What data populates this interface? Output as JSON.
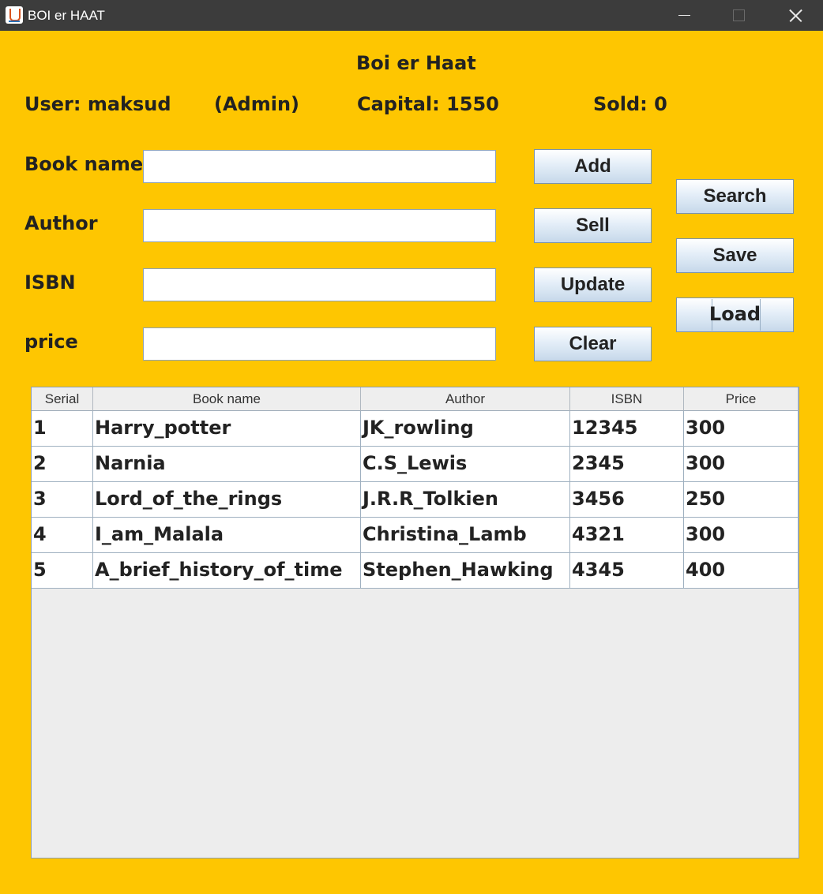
{
  "window": {
    "title": "BOI er HAAT"
  },
  "header": {
    "app_name": "Boi er Haat",
    "user": "User: maksud",
    "role": "(Admin)",
    "capital": "Capital: 1550",
    "sold": "Sold: 0"
  },
  "form": {
    "book_name_label": "Book name",
    "book_name_value": "",
    "author_label": "Author",
    "author_value": "",
    "isbn_label": "ISBN",
    "isbn_value": "",
    "price_label": "price",
    "price_value": ""
  },
  "buttons": {
    "add": "Add",
    "sell": "Sell",
    "update": "Update",
    "clear": "Clear",
    "search": "Search",
    "save": "Save",
    "load": "Load"
  },
  "table": {
    "columns": [
      "Serial",
      "Book name",
      "Author",
      "ISBN",
      "Price"
    ],
    "rows": [
      [
        "1",
        "Harry_potter",
        "JK_rowling",
        "12345",
        "300"
      ],
      [
        "2",
        "Narnia",
        "C.S_Lewis",
        "2345",
        "300"
      ],
      [
        "3",
        "Lord_of_the_rings",
        "J.R.R_Tolkien",
        "3456",
        "250"
      ],
      [
        "4",
        "I_am_Malala",
        "Christina_Lamb",
        "4321",
        "300"
      ],
      [
        "5",
        "A_brief_history_of_time",
        "Stephen_Hawking",
        "4345",
        "400"
      ]
    ]
  }
}
